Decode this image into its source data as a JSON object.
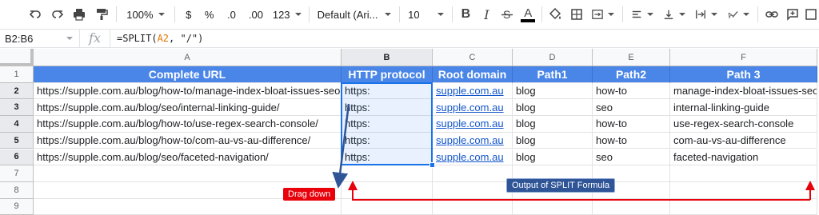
{
  "toolbar": {
    "zoom": "100%",
    "currency": "$",
    "percent": "%",
    "decrease_decimal": ".0",
    "increase_decimal": ".00",
    "number_format": "123",
    "font": "Default (Ari...",
    "font_size": "10",
    "bold": "B",
    "italic": "I",
    "text_color_glyph": "A"
  },
  "formula_bar": {
    "name_box": "B2:B6",
    "fx": "fx",
    "formula_prefix": "=SPLIT(",
    "formula_ref": "A2",
    "formula_suffix": ", \"/\")"
  },
  "columns": [
    "A",
    "B",
    "C",
    "D",
    "E",
    "F"
  ],
  "rows": [
    "1",
    "2",
    "3",
    "4",
    "5",
    "6",
    "7",
    "8",
    "9"
  ],
  "header_row": [
    "Complete URL",
    "HTTP protocol",
    "Root domain",
    "Path1",
    "Path2",
    "Path 3"
  ],
  "data_rows": [
    [
      "https://supple.com.au/blog/how-to/manage-index-bloat-issues-seo",
      "https:",
      "supple.com.au",
      "blog",
      "how-to",
      "manage-index-bloat-issues-seo"
    ],
    [
      "https://supple.com.au/blog/seo/internal-linking-guide/",
      "https:",
      "supple.com.au",
      "blog",
      "seo",
      "internal-linking-guide"
    ],
    [
      "https://supple.com.au/blog/how-to/use-regex-search-console/",
      "https:",
      "supple.com.au",
      "blog",
      "how-to",
      "use-regex-search-console"
    ],
    [
      "https://supple.com.au/blog/how-to/com-au-vs-au-difference/",
      "https:",
      "supple.com.au",
      "blog",
      "how-to",
      "com-au-vs-au-difference"
    ],
    [
      "https://supple.com.au/blog/seo/faceted-navigation/",
      "https:",
      "supple.com.au",
      "blog",
      "seo",
      "faceted-navigation"
    ]
  ],
  "annotations": {
    "drag_down": "Drag down",
    "output_label": "Output of SPLIT Formula",
    "red": "#e8000b",
    "blue": "#2f5597"
  },
  "colors": {
    "header_bg": "#4a86e8",
    "selection": "#1a73e8",
    "link": "#1155cc"
  }
}
